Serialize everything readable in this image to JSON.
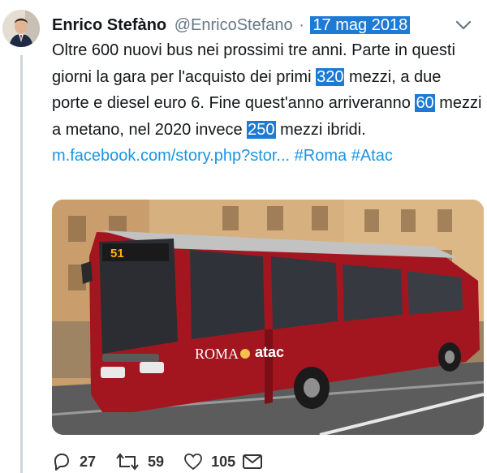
{
  "tweet": {
    "author_name": "Enrico Stefàno",
    "handle": "@EnricoStefano",
    "separator": "·",
    "date": "17 mag 2018",
    "text_parts": {
      "p1": "Oltre 600 nuovi bus nei prossimi tre anni. Parte in questi giorni la gara per l'acquisto dei primi ",
      "n1": "320",
      "p2": " mezzi, a due porte e diesel euro 6. Fine quest'anno arriveranno ",
      "n2": "60",
      "p3": " mezzi a metano, nel 2020 invece ",
      "n3": "250",
      "p4": " mezzi ibridi. ",
      "link": "m.facebook.com/story.php?stor...",
      "hashtag1": "#Roma",
      "hashtag2": "#Atac"
    },
    "image": {
      "bus_sign": "51",
      "bus_brand": "ROMA atac",
      "bus_brand_roma": "ROMA",
      "bus_brand_atac": "atac"
    },
    "actions": {
      "replies": "27",
      "retweets": "59",
      "likes": "105"
    },
    "colors": {
      "highlight": "#1d7bd6",
      "link": "#1b95e0",
      "bus_red": "#a4161f"
    }
  }
}
